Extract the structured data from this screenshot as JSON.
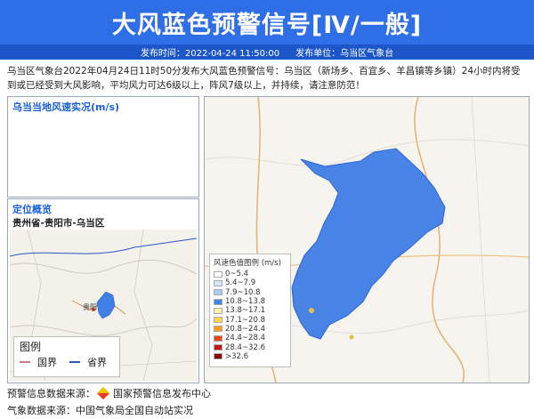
{
  "header": {
    "title": "大风蓝色预警信号[Ⅳ/一般]"
  },
  "meta": {
    "publish_time": "发布时间：2022-04-24 11:50:00",
    "publish_unit": "发布单位：乌当区气象台"
  },
  "description": "乌当区气象台2022年04月24日11时50分发布大风蓝色预警信号：乌当区（新场乡、百宜乡、羊昌镇等乡镇）24小时内将受到或已经受到大风影响，平均风力可达6级以上，阵风7级以上，并持续，请注意防范！",
  "wind_panel": {
    "title": "乌当当地风速实况(m/s)"
  },
  "location_panel": {
    "title": "定位概览",
    "region": "贵州省-贵阳市-乌当区",
    "map_labels": {
      "guiyang": "贵阳"
    },
    "legend_title": "图例",
    "legend_items": [
      "国界",
      "省界"
    ]
  },
  "wind_legend": {
    "title": "风速色值图例 (m/s)",
    "items": [
      {
        "label": "0~5.4",
        "color": "#ffffff"
      },
      {
        "label": "5.4~7.9",
        "color": "#d6e6fb"
      },
      {
        "label": "7.9~10.8",
        "color": "#a8ccf5"
      },
      {
        "label": "10.8~13.8",
        "color": "#3f86e8"
      },
      {
        "label": "13.8~17.1",
        "color": "#fff2a6"
      },
      {
        "label": "17.1~20.8",
        "color": "#ffd44d"
      },
      {
        "label": "20.8~24.4",
        "color": "#ff9a1f"
      },
      {
        "label": "24.4~28.4",
        "color": "#f0421a"
      },
      {
        "label": "28.4~32.6",
        "color": "#c81313"
      },
      {
        "label": ">32.6",
        "color": "#8a0505"
      }
    ]
  },
  "footer": {
    "warning_source_label": "预警信息数据来源：",
    "warning_source": "国家预警信息发布中心",
    "weather_source": "气象数据来源：中国气象局全国自动站实况"
  }
}
